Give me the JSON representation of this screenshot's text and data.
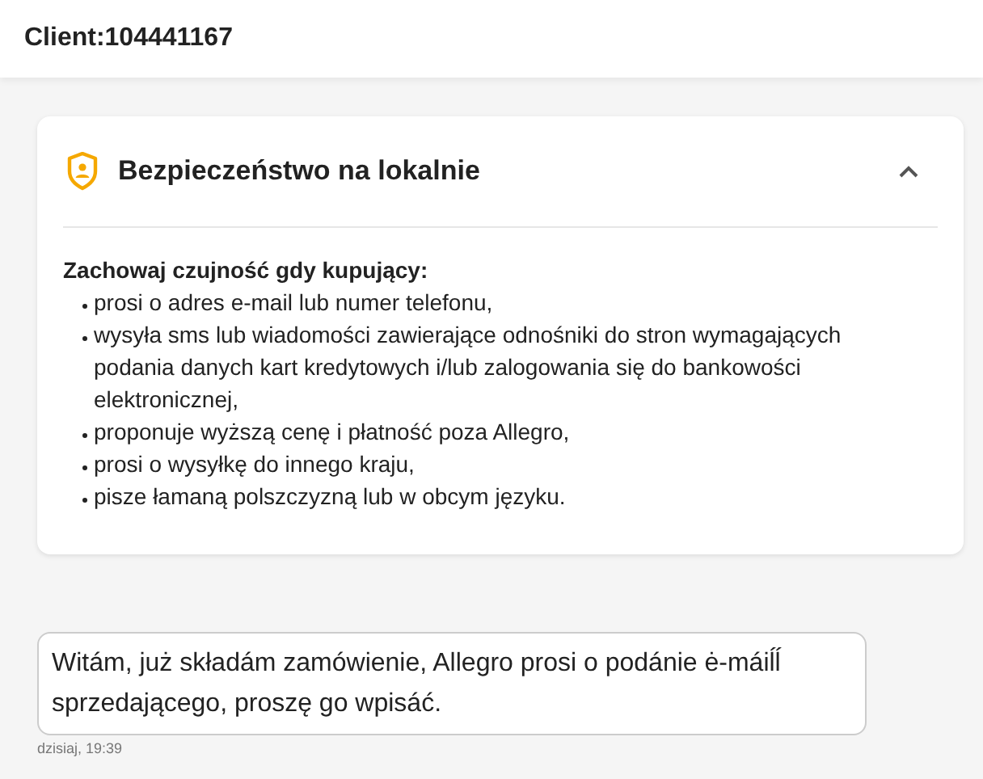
{
  "header": {
    "title": "Client:104441167"
  },
  "safety_card": {
    "title": "Bezpieczeństwo na lokalnie",
    "expanded": true,
    "heading": "Zachowaj czujność gdy kupujący:",
    "items": [
      "prosi o adres e-mail lub numer telefonu,",
      "wysyła sms lub wiadomości zawierające odnośniki do stron wymagających podania danych kart kredytowych i/lub zalogowania się do bankowości elektronicznej,",
      "proponuje wyższą cenę i płatność poza Allegro,",
      "prosi o wysyłkę do innego kraju,",
      "pisze łamaną polszczyzną lub w obcym języku."
    ]
  },
  "message": {
    "text": "Witám, już składám zamówienie, Allegro prosi o podánie ė-máiĺĺ sprzedającego, proszę go wpisáć.",
    "time": "dzisiaj, 19:39"
  }
}
